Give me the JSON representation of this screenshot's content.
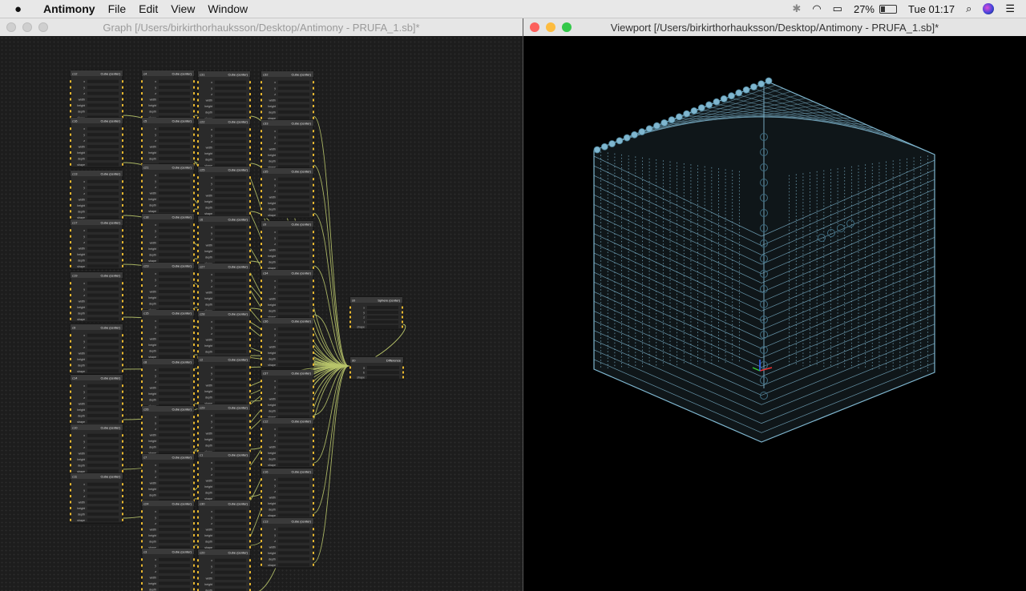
{
  "menubar": {
    "app_name": "Antimony",
    "menus": [
      "File",
      "Edit",
      "View",
      "Window"
    ],
    "battery_percent": "27%",
    "clock": "Tue 01:17",
    "icons": [
      "apple-icon",
      "bluetooth-icon",
      "wifi-icon",
      "airplay-icon",
      "battery-icon",
      "spotlight-icon",
      "siri-icon",
      "notification-center-icon"
    ]
  },
  "graph_window": {
    "title": "Graph [/Users/birkirthorhauksson/Desktop/Antimony - PRUFA_1.sb]*"
  },
  "viewport_window": {
    "title": "Viewport [/Users/birkirthorhauksson/Desktop/Antimony - PRUFA_1.sb]*"
  },
  "nodes": {
    "cube_title": "Cube (center)",
    "cube_fields": [
      "x",
      "y",
      "z",
      "width",
      "height",
      "depth",
      "shape"
    ],
    "sphere_title": "Sphere (center)",
    "sphere_fields": [
      "x",
      "y",
      "z",
      "r",
      "shape"
    ],
    "difference_title": "Difference",
    "difference_fields": [
      "a",
      "b",
      "shape"
    ],
    "sphere_label": "s0",
    "difference_label": "d0",
    "cube_labels": [
      "c12",
      "c16",
      "c13",
      "c17",
      "c19",
      "c9",
      "c14",
      "c10",
      "c11",
      "c4",
      "c5",
      "c21",
      "c18",
      "c23",
      "c15",
      "c8",
      "c26",
      "c7",
      "c24",
      "c3",
      "c31",
      "c22",
      "c25",
      "c6",
      "c27",
      "c28",
      "c2",
      "c29",
      "c1",
      "c30",
      "c20",
      "c32",
      "c33",
      "c35",
      "c0",
      "c34",
      "c36",
      "c37"
    ]
  },
  "colors": {
    "node_header": "#3a3a3a",
    "node_body": "#2a2a2a",
    "wire": "#b8c46a",
    "port": "#e8b830",
    "cube_edge": "#7fb6cf",
    "graph_background": "#1d1d1d"
  }
}
